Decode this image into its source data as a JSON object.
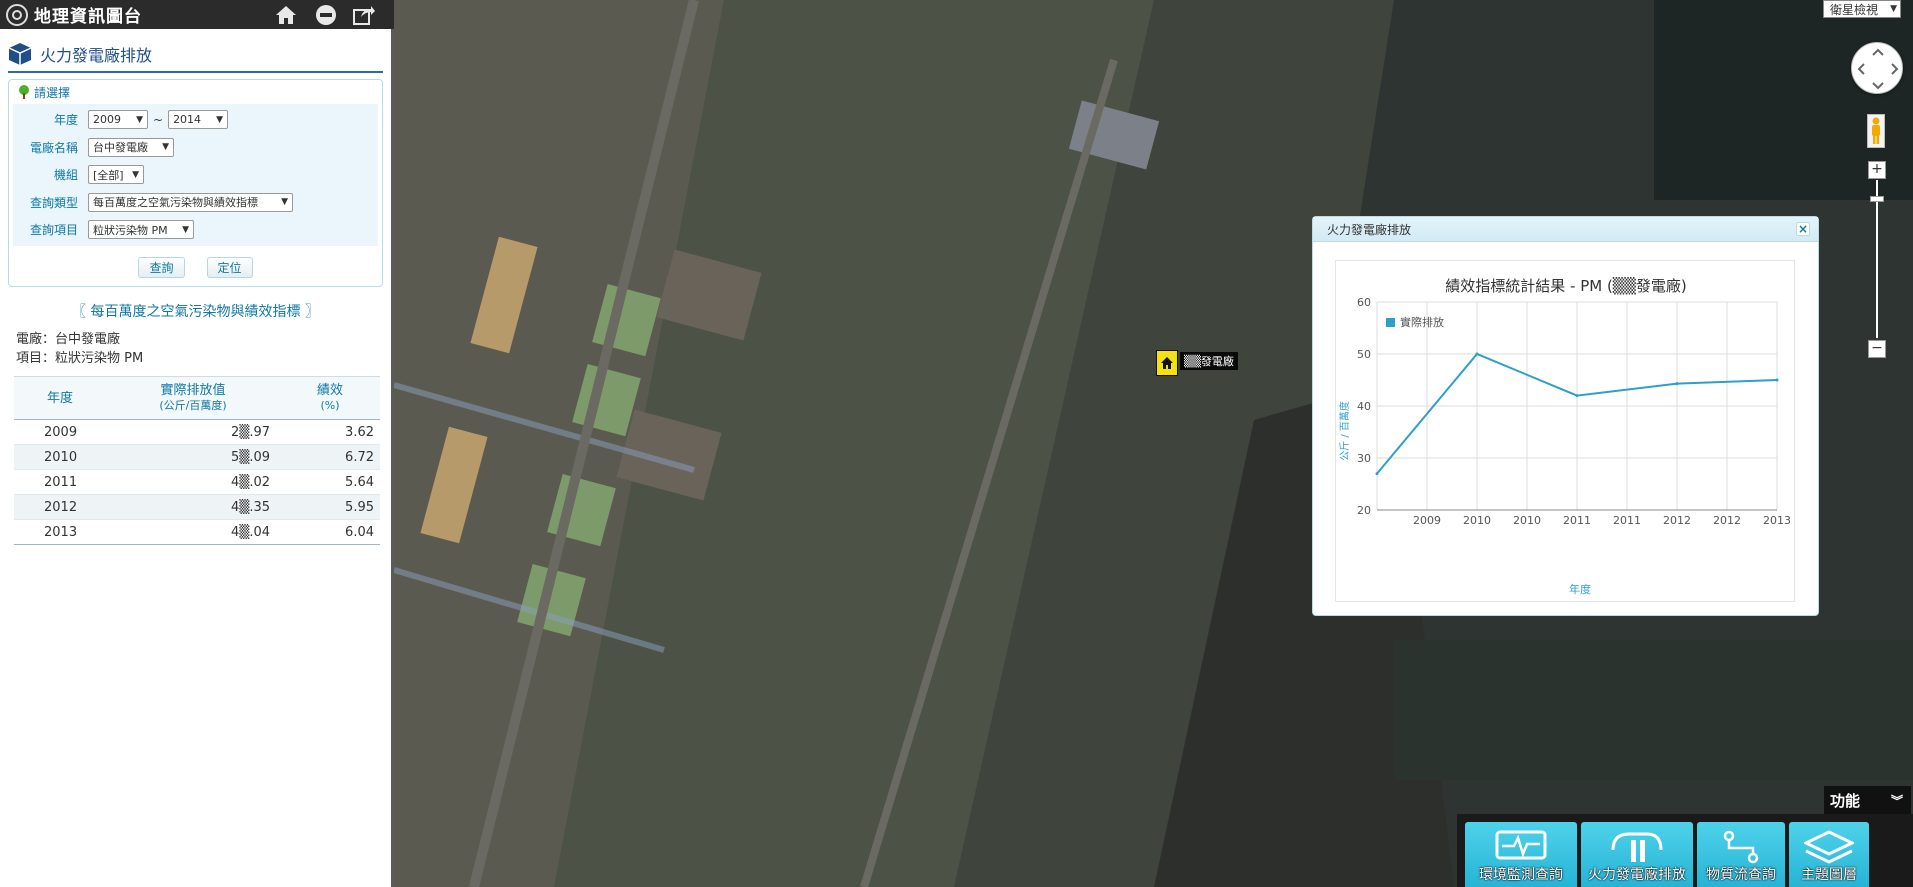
{
  "topbar": {
    "app_title": "地理資訊圖台",
    "icons": [
      "home-icon",
      "minus-circle-icon",
      "share-icon"
    ]
  },
  "panel": {
    "title": "火力發電廠排放",
    "query": {
      "heading": "請選擇",
      "year_label": "年度",
      "year_from": "2009",
      "year_sep": "~",
      "year_to": "2014",
      "plant_label": "電廠名稱",
      "plant_value": "台中發電廠",
      "unit_label": "機組",
      "unit_value": "[全部]",
      "type_label": "查詢類型",
      "type_value": "每百萬度之空氣污染物與績效指標",
      "item_label": "查詢項目",
      "item_value": "粒狀污染物 PM",
      "query_button": "查詢",
      "locate_button": "定位"
    },
    "result": {
      "title": "〖 每百萬度之空氣污染物與績效指標 〗",
      "plant_line": "電廠：台中發電廠",
      "item_line": "項目：粒狀污染物 PM",
      "columns": {
        "year": "年度",
        "value": "實際排放值",
        "value_unit": "(公斤/百萬度)",
        "perf": "績效",
        "perf_unit": "(%)"
      },
      "rows": [
        {
          "year": "2009",
          "value": "2▒.97",
          "perf": "3.62"
        },
        {
          "year": "2010",
          "value": "5▒.09",
          "perf": "6.72"
        },
        {
          "year": "2011",
          "value": "4▒.02",
          "perf": "5.64"
        },
        {
          "year": "2012",
          "value": "4▒.35",
          "perf": "5.95"
        },
        {
          "year": "2013",
          "value": "4▒.04",
          "perf": "6.04"
        }
      ]
    }
  },
  "map": {
    "map_type": "衛星檢視",
    "marker_label": "▒▒發電廠",
    "zoom_in": "+",
    "zoom_out": "−"
  },
  "popup": {
    "title": "火力發電廠排放",
    "close": "×"
  },
  "chart_data": {
    "type": "line",
    "title": "績效指標統計結果 - PM (▒▒發電廠)",
    "xlabel": "年度",
    "ylabel": "公斤 / 百萬度",
    "x_tick_labels": [
      "2009",
      "2010",
      "2010",
      "2011",
      "2011",
      "2012",
      "2012",
      "2013"
    ],
    "ylim": [
      20,
      60
    ],
    "y_ticks": [
      20,
      30,
      40,
      50,
      60
    ],
    "grid": true,
    "legend_position": "top-left",
    "series": [
      {
        "name": "實際排放",
        "color": "#2f9fc8",
        "x": [
          0,
          1,
          2,
          3,
          4
        ],
        "values": [
          27,
          50,
          42,
          44.3,
          45
        ]
      }
    ]
  },
  "functions": {
    "label": "功能",
    "buttons": [
      {
        "label": "環境監測查詢",
        "icon": "monitor-icon"
      },
      {
        "label": "火力發電廠排放",
        "icon": "power-plant-icon"
      },
      {
        "label": "物質流查詢",
        "icon": "flow-icon"
      },
      {
        "label": "主題圖層",
        "icon": "layers-icon"
      }
    ]
  }
}
